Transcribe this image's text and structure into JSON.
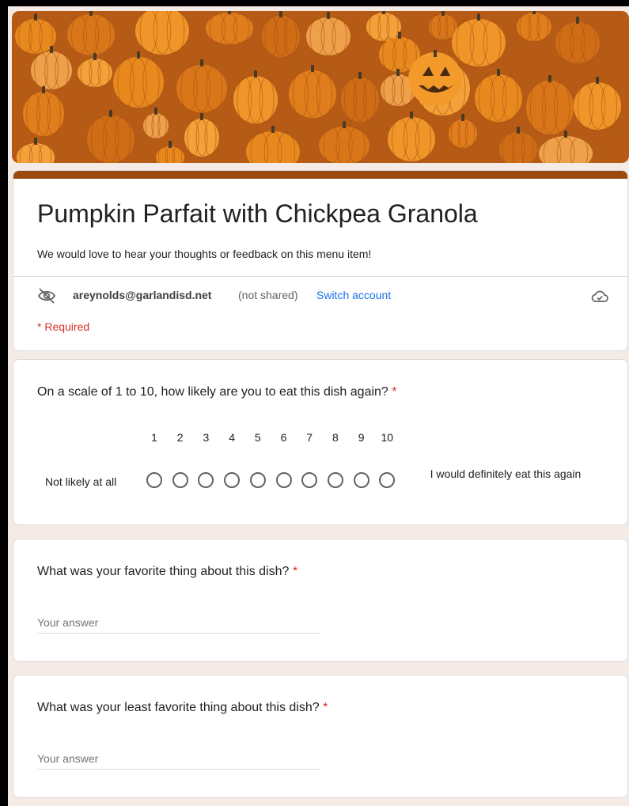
{
  "form": {
    "title": "Pumpkin Parfait with Chickpea Granola",
    "description": "We would love to hear your thoughts or feedback on this menu item!",
    "account_email": "areynolds@garlandisd.net",
    "account_note": "(not shared)",
    "switch_account_label": "Switch account",
    "required_note": "* Required"
  },
  "colors": {
    "theme": "#9b4a0e",
    "banner_bg": "#b55b16",
    "page_bg": "#f4ebe7",
    "link": "#1a73e8",
    "required": "#d93025"
  },
  "icons": {
    "visibility_off": "eye-off-icon",
    "cloud": "cloud-check-icon"
  },
  "questions": [
    {
      "text": "On a scale of 1 to 10, how likely are you to eat this dish again?",
      "required_mark": "*",
      "type": "linear-scale",
      "scale": [
        "1",
        "2",
        "3",
        "4",
        "5",
        "6",
        "7",
        "8",
        "9",
        "10"
      ],
      "low_label": "Not likely at all",
      "high_label": "I would definitely eat this again"
    },
    {
      "text": "What was your favorite thing about this dish?",
      "required_mark": "*",
      "type": "short-answer",
      "placeholder": "Your answer"
    },
    {
      "text": "What was your least favorite thing about this dish?",
      "required_mark": "*",
      "type": "short-answer",
      "placeholder": "Your answer"
    }
  ]
}
